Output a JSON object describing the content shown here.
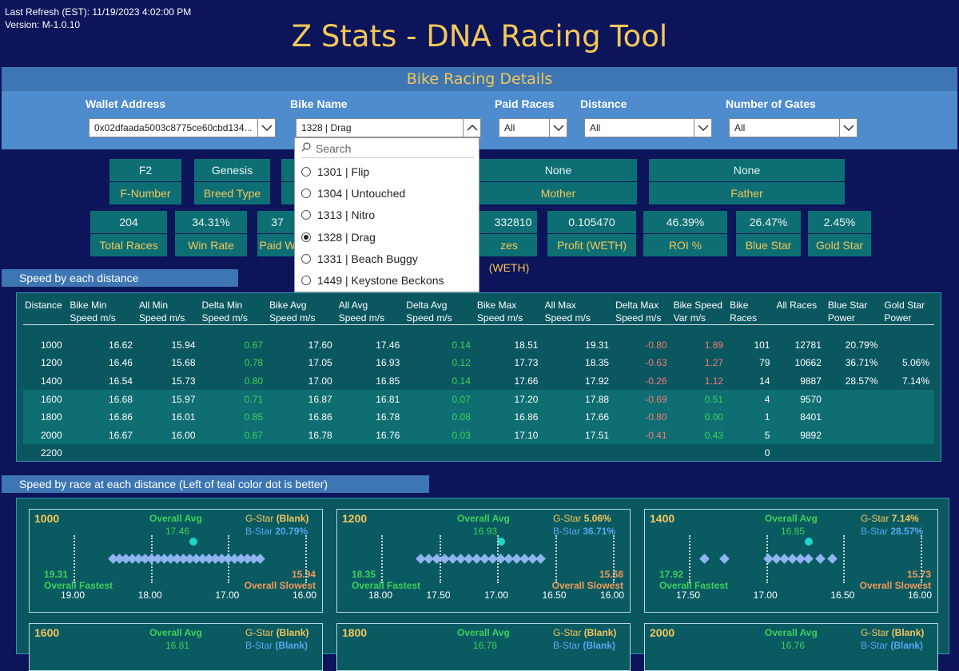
{
  "header": {
    "refresh": "Last Refresh (EST):  11/19/2023 4:02:00 PM",
    "version": "Version:  M-1.0.10",
    "title": "Z Stats - DNA Racing Tool",
    "band": "Bike Racing Details"
  },
  "filters": {
    "wallet": {
      "label": "Wallet Address",
      "value": "0x02dfaada5003c8775ce60cbd134..."
    },
    "bike": {
      "label": "Bike Name",
      "value": "1328 | Drag"
    },
    "paid": {
      "label": "Paid Races",
      "value": "All"
    },
    "distance": {
      "label": "Distance",
      "value": "All"
    },
    "gates": {
      "label": "Number of Gates",
      "value": "All"
    }
  },
  "dropdown": {
    "search_placeholder": "Search",
    "items": [
      {
        "label": "1301 | Flip",
        "selected": false
      },
      {
        "label": "1304 | Untouched",
        "selected": false
      },
      {
        "label": "1313 | Nitro",
        "selected": false
      },
      {
        "label": "1328 | Drag",
        "selected": true
      },
      {
        "label": "1331 | Beach Buggy",
        "selected": false
      },
      {
        "label": "1449 | Keystone Beckons",
        "selected": false
      }
    ]
  },
  "info": {
    "fnum": "F2",
    "fnum_label": "F-Number",
    "breed": "Genesis",
    "breed_label": "Breed Type",
    "mother": "None",
    "mother_label": "Mother",
    "father": "None",
    "father_label": "Father"
  },
  "stats": [
    {
      "value": "204",
      "label": "Total Races"
    },
    {
      "value": "34.31%",
      "label": "Win Rate"
    },
    {
      "value": "37",
      "label": "Paid W"
    },
    {
      "value": "332810",
      "label": "zes (WETH)"
    },
    {
      "value": "0.105470",
      "label": "Profit (WETH)"
    },
    {
      "value": "46.39%",
      "label": "ROI %"
    },
    {
      "value": "26.47%",
      "label": "Blue Star"
    },
    {
      "value": "2.45%",
      "label": "Gold Star"
    }
  ],
  "sections": {
    "speed": "Speed by each distance",
    "race": "Speed by race at each distance (Left of teal color dot is better)"
  },
  "table": {
    "headers": [
      [
        "Distance",
        ""
      ],
      [
        "Bike Min",
        "Speed m/s"
      ],
      [
        "All Min",
        "Speed m/s"
      ],
      [
        "Delta Min",
        "Speed m/s"
      ],
      [
        "Bike Avg",
        "Speed m/s"
      ],
      [
        "All Avg",
        "Speed m/s"
      ],
      [
        "Delta Avg",
        "Speed m/s"
      ],
      [
        "Bike Max",
        "Speed m/s"
      ],
      [
        "All Max",
        "Speed m/s"
      ],
      [
        "Delta Max",
        "Speed m/s"
      ],
      [
        "Bike Speed",
        "Var m/s"
      ],
      [
        "Bike",
        "Races"
      ],
      [
        "All Races",
        ""
      ],
      [
        "Blue Star",
        "Power"
      ],
      [
        "Gold Star",
        "Power"
      ]
    ],
    "rows": [
      [
        "1000",
        "16.62",
        "15.94",
        "0.67",
        "17.60",
        "17.46",
        "0.14",
        "18.51",
        "19.31",
        "-0.80",
        "1.89",
        "101",
        "12781",
        "20.79%",
        ""
      ],
      [
        "1200",
        "16.46",
        "15.68",
        "0.78",
        "17.05",
        "16.93",
        "0.12",
        "17.73",
        "18.35",
        "-0.63",
        "1.27",
        "79",
        "10662",
        "36.71%",
        "5.06%"
      ],
      [
        "1400",
        "16.54",
        "15.73",
        "0.80",
        "17.00",
        "16.85",
        "0.14",
        "17.66",
        "17.92",
        "-0.26",
        "1.12",
        "14",
        "9887",
        "28.57%",
        "7.14%"
      ],
      [
        "1600",
        "16.68",
        "15.97",
        "0.71",
        "16.87",
        "16.81",
        "0.07",
        "17.20",
        "17.88",
        "-0.69",
        "0.51",
        "4",
        "9570",
        "",
        ""
      ],
      [
        "1800",
        "16.86",
        "16.01",
        "0.85",
        "16.86",
        "16.78",
        "0.08",
        "16.86",
        "17.66",
        "-0.80",
        "0.00",
        "1",
        "8401",
        "",
        ""
      ],
      [
        "2000",
        "16.67",
        "16.00",
        "0.67",
        "16.78",
        "16.76",
        "0.03",
        "17.10",
        "17.51",
        "-0.41",
        "0.43",
        "5",
        "9892",
        "",
        ""
      ],
      [
        "2200",
        "",
        "",
        "",
        "",
        "",
        "",
        "",
        "",
        "",
        "",
        "0",
        "",
        "",
        ""
      ]
    ]
  },
  "colors": {
    "bg": "#0c145a",
    "gold": "#f3c75b",
    "teal": "#0d6f74",
    "green": "#3ed05a",
    "red": "#f07a7a",
    "diamond": "#8fb4f0",
    "dot": "#1fd6c8"
  },
  "charts": [
    {
      "dist": "1000",
      "avg_label": "Overall Avg",
      "avg": "17.46",
      "gstar": "(Blank)",
      "bstar": "20.79%",
      "fast": "19.31",
      "slow": "15.94",
      "fast_label": "Overall Fastest",
      "slow_label": "Overall Slowest",
      "ticks": [
        "19.00",
        "18.00",
        "17.00",
        "16.00"
      ]
    },
    {
      "dist": "1200",
      "avg_label": "Overall Avg",
      "avg": "16.93",
      "gstar": "5.06%",
      "bstar": "36.71%",
      "fast": "18.35",
      "slow": "15.68",
      "fast_label": "Overall Fastest",
      "slow_label": "Overall Slowest",
      "ticks": [
        "18.00",
        "17.50",
        "17.00",
        "16.50",
        "16.00"
      ]
    },
    {
      "dist": "1400",
      "avg_label": "Overall Avg",
      "avg": "16.85",
      "gstar": "7.14%",
      "bstar": "28.57%",
      "fast": "17.92",
      "slow": "15.73",
      "fast_label": "Overall Fastest",
      "slow_label": "Overall Slowest",
      "ticks": [
        "17.50",
        "17.00",
        "16.50",
        "16.00"
      ]
    },
    {
      "dist": "1600",
      "avg_label": "Overall Avg",
      "avg": "16.81",
      "gstar": "(Blank)",
      "bstar": "(Blank)"
    },
    {
      "dist": "1800",
      "avg_label": "Overall Avg",
      "avg": "16.78",
      "gstar": "(Blank)",
      "bstar": "(Blank)"
    },
    {
      "dist": "2000",
      "avg_label": "Overall Avg",
      "avg": "16.76",
      "gstar": "(Blank)",
      "bstar": "(Blank)"
    }
  ],
  "gstar_label": "G-Star",
  "bstar_label": "B-Star"
}
